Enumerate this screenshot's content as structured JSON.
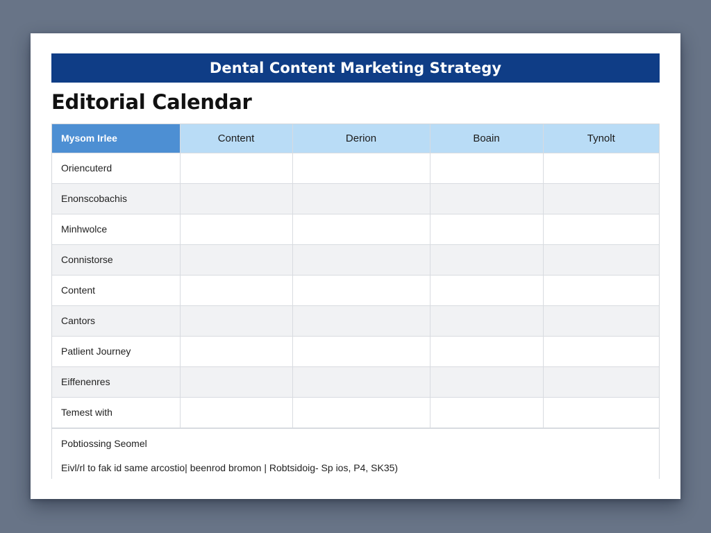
{
  "document": {
    "banner_title": "Dental Content Marketing Strategy",
    "section_title": "Editorial Calendar"
  },
  "calendar": {
    "columns": [
      "Mysom Irlee",
      "Content",
      "Derion",
      "Boain",
      "Tynolt"
    ],
    "rows": [
      {
        "label": "Oriencuterd",
        "cells": [
          "",
          "",
          "",
          ""
        ]
      },
      {
        "label": "Enonscobachis",
        "cells": [
          "",
          "",
          "",
          ""
        ]
      },
      {
        "label": "Minhwolce",
        "cells": [
          "",
          "",
          "",
          ""
        ]
      },
      {
        "label": "Connistorse",
        "cells": [
          "",
          "",
          "",
          ""
        ]
      },
      {
        "label": "Content",
        "cells": [
          "",
          "",
          "",
          ""
        ]
      },
      {
        "label": "Cantors",
        "cells": [
          "",
          "",
          "",
          ""
        ]
      },
      {
        "label": "Patlient Journey",
        "cells": [
          "",
          "",
          "",
          ""
        ]
      },
      {
        "label": "Eiffenenres",
        "cells": [
          "",
          "",
          "",
          ""
        ]
      },
      {
        "label": "Temest with",
        "cells": [
          "",
          "",
          "",
          ""
        ]
      }
    ],
    "footer_title": "Pobtiossing Seomel",
    "footer_note": "Eivl/rl to fak id same arcostio| beenrod bromon | Robtsidoig- Sp ios, P4, SK35)"
  },
  "colors": {
    "background": "#687487",
    "banner": "#0f3d86",
    "header_row": "#b9dcf6",
    "header_first_cell": "#4d8fd3",
    "alt_row": "#f1f2f4"
  }
}
